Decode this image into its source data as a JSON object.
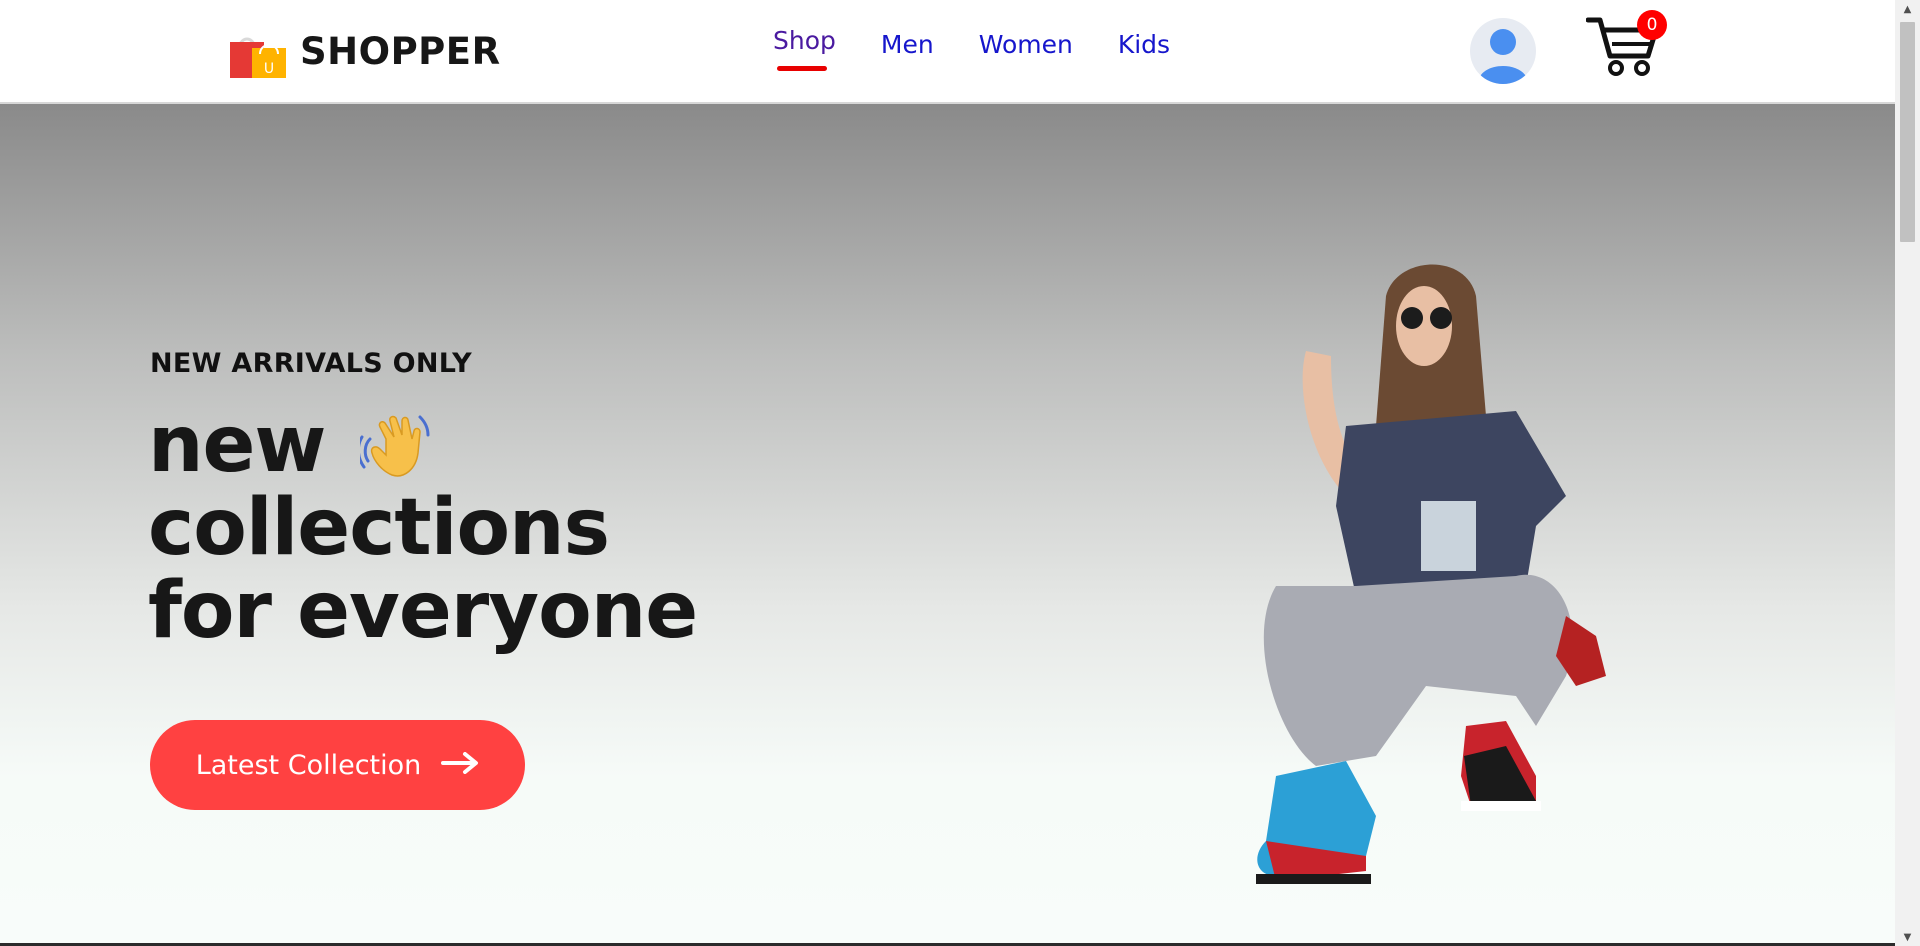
{
  "brand": {
    "name": "SHOPPER",
    "logo_icon": "shopping-bags-icon",
    "logo_bag_letter": "U"
  },
  "nav": {
    "items": [
      {
        "label": "Shop",
        "active": true
      },
      {
        "label": "Men",
        "active": false
      },
      {
        "label": "Women",
        "active": false
      },
      {
        "label": "Kids",
        "active": false
      }
    ]
  },
  "user": {
    "icon": "user-avatar-icon"
  },
  "cart": {
    "icon": "cart-icon",
    "count": "0"
  },
  "hero": {
    "kicker": "NEW ARRIVALS ONLY",
    "line1": "new",
    "line2": "collections",
    "line3": "for everyone",
    "wave_icon": "waving-hand-icon",
    "cta_label": "Latest Collection",
    "cta_icon": "arrow-right-icon",
    "image": "hero-model-image"
  },
  "colors": {
    "accent": "#ff4141",
    "nav_link": "#1616cc",
    "active_underline": "#e80000",
    "badge": "#ff0000"
  }
}
